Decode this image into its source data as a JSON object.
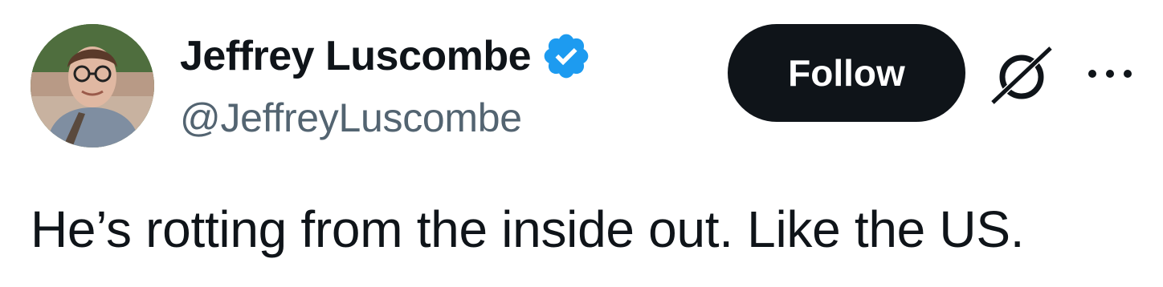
{
  "author": {
    "display_name": "Jeffrey Luscombe",
    "handle": "@JeffreyLuscombe",
    "verified": true,
    "avatar_icon": "profile-photo"
  },
  "actions": {
    "follow_label": "Follow",
    "grok_icon": "grok-icon",
    "more_icon": "more-dots-icon"
  },
  "tweet": {
    "text": "He’s rotting from the inside out. Like the US."
  },
  "colors": {
    "text_primary": "#0f1419",
    "text_secondary": "#536471",
    "verified_blue": "#1d9bf0",
    "follow_bg": "#0f1419",
    "follow_text": "#ffffff",
    "background": "#ffffff"
  }
}
